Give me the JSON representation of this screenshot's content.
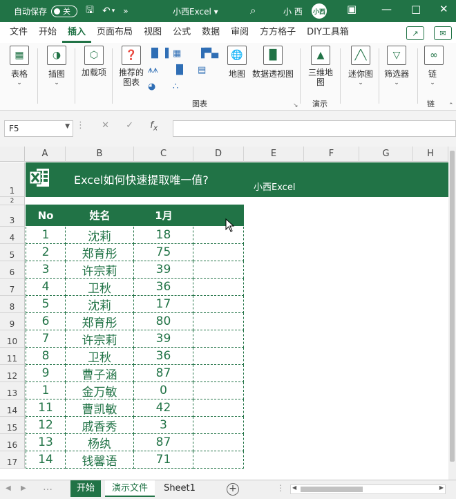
{
  "titlebar": {
    "autosave_label": "自动保存",
    "autosave_state": "关",
    "doc_title": "小西Excel",
    "username": "小 西",
    "avatar_text": "小西",
    "colors": {
      "brand": "#217346"
    }
  },
  "ribbon_tabs": [
    "文件",
    "开始",
    "插入",
    "页面布局",
    "视图",
    "公式",
    "数据",
    "审阅",
    "方方格子",
    "DIY工具箱"
  ],
  "active_tab": "插入",
  "ribbon": {
    "table": "表格",
    "illustrations": "插图",
    "addins": "加载项",
    "recommended_charts": "推荐的图表",
    "map": "地图",
    "pivot_chart": "数据透视图",
    "map3d": "三维地图",
    "sparklines": "迷你图",
    "filters": "筛选器",
    "links": "链",
    "group_charts": "图表",
    "group_demo": "演示",
    "group_links": "链"
  },
  "formula_bar": {
    "name_box": "F5",
    "formula": ""
  },
  "columns": [
    "A",
    "B",
    "C",
    "D",
    "E",
    "F",
    "G",
    "H"
  ],
  "rows": [
    "1",
    "2",
    "3",
    "4",
    "5",
    "6",
    "7",
    "8",
    "9",
    "10",
    "11",
    "12",
    "13",
    "14",
    "15",
    "16",
    "17"
  ],
  "banner": {
    "title": "Excel如何快速提取唯一值?",
    "subtitle": "小西Excel"
  },
  "table": {
    "headers": [
      "No",
      "姓名",
      "1月"
    ],
    "rows": [
      [
        "1",
        "沈莉",
        "18"
      ],
      [
        "2",
        "郑育彤",
        "75"
      ],
      [
        "3",
        "许宗莉",
        "39"
      ],
      [
        "4",
        "卫秋",
        "36"
      ],
      [
        "5",
        "沈莉",
        "17"
      ],
      [
        "6",
        "郑育彤",
        "80"
      ],
      [
        "7",
        "许宗莉",
        "39"
      ],
      [
        "8",
        "卫秋",
        "36"
      ],
      [
        "9",
        "曹子涵",
        "87"
      ],
      [
        "1",
        "金万敏",
        "0"
      ],
      [
        "11",
        "曹凯敏",
        "42"
      ],
      [
        "12",
        "戚香秀",
        "3"
      ],
      [
        "13",
        "杨纨",
        "87"
      ],
      [
        "14",
        "钱馨语",
        "71"
      ]
    ]
  },
  "sheets": [
    "开始",
    "演示文件",
    "Sheet1"
  ],
  "active_sheet": "演示文件"
}
